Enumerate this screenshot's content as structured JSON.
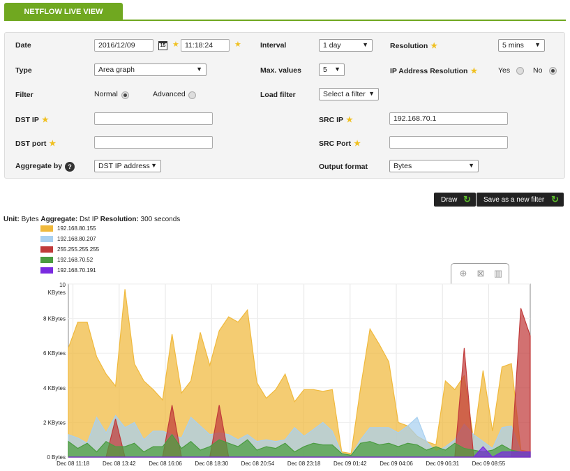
{
  "tab": {
    "label": "NETFLOW LIVE VIEW"
  },
  "form": {
    "date_label": "Date",
    "date_value": "2016/12/09",
    "time_value": "11:18:24",
    "interval_label": "Interval",
    "interval_value": "1 day",
    "resolution_label": "Resolution",
    "resolution_value": "5 mins",
    "type_label": "Type",
    "type_value": "Area graph",
    "maxvalues_label": "Max. values",
    "maxvalues_value": "5",
    "ipres_label": "IP Address Resolution",
    "yes_label": "Yes",
    "no_label": "No",
    "filter_label": "Filter",
    "normal_label": "Normal",
    "advanced_label": "Advanced",
    "loadfilter_label": "Load filter",
    "loadfilter_value": "Select a filter",
    "dstip_label": "DST IP",
    "dstip_value": "",
    "srcip_label": "SRC IP",
    "srcip_value": "192.168.70.1",
    "dstport_label": "DST port",
    "dstport_value": "",
    "srcport_label": "SRC Port",
    "srcport_value": "",
    "aggregate_label": "Aggregate by",
    "aggregate_value": "DST IP address",
    "output_label": "Output format",
    "output_value": "Bytes",
    "calendar_day": "15"
  },
  "buttons": {
    "draw": "Draw",
    "save": "Save as a new filter"
  },
  "summary": {
    "unit_label": "Unit:",
    "unit_value": "Bytes",
    "agg_label": "Aggregate:",
    "agg_value": "Dst IP",
    "res_label": "Resolution:",
    "res_value": "300 seconds"
  },
  "icons": {
    "zoom": "zoom-icon",
    "reset": "reset-zoom-icon",
    "chart": "chart-type-icon",
    "refresh": "refresh-icon",
    "help": "help-icon",
    "calendar": "calendar-icon"
  },
  "colors": {
    "accent": "#70a820"
  },
  "chart_data": {
    "type": "area",
    "ylabel": "",
    "ylim": [
      0,
      10
    ],
    "yticks": [
      "0 Bytes",
      "2 KBytes",
      "4 KBytes",
      "6 KBytes",
      "8 KBytes",
      "10 KBytes"
    ],
    "ytick_values": [
      0,
      2,
      4,
      6,
      8,
      10
    ],
    "xticks": [
      "Dec 08 11:18",
      "Dec 08 13:42",
      "Dec 08 16:06",
      "Dec 08 18:30",
      "Dec 08 20:54",
      "Dec 08 23:18",
      "Dec 09 01:42",
      "Dec 09 04:06",
      "Dec 09 06:31",
      "Dec 09 08:55"
    ],
    "grid": true,
    "legend_position": "top-left",
    "series": [
      {
        "name": "192.168.80.155",
        "color": "#f0b93c",
        "values": [
          6.3,
          7.8,
          7.8,
          5.8,
          4.8,
          4.1,
          9.7,
          5.4,
          4.4,
          3.9,
          3.3,
          7.1,
          3.7,
          4.4,
          7.2,
          5.3,
          7.3,
          8.1,
          7.8,
          8.5,
          4.3,
          3.4,
          3.9,
          4.8,
          3.2,
          3.9,
          3.9,
          3.8,
          3.9,
          0.3,
          0.2,
          4.0,
          7.4,
          6.5,
          5.5,
          2.0,
          1.8,
          1.2,
          0.9,
          0.7,
          4.4,
          3.9,
          4.7,
          1.0,
          5.0,
          1.5,
          5.2,
          5.4,
          0.4,
          0.3
        ]
      },
      {
        "name": "192.168.80.207",
        "color": "#a8d0f0",
        "values": [
          1.3,
          1.1,
          0.8,
          2.3,
          1.4,
          2.4,
          1.7,
          2.0,
          1.0,
          1.5,
          1.5,
          1.3,
          1.1,
          2.3,
          1.8,
          1.3,
          1.4,
          1.3,
          1.0,
          1.3,
          0.9,
          1.0,
          0.9,
          1.0,
          1.7,
          1.2,
          1.6,
          2.0,
          1.5,
          0.2,
          0.1,
          1.0,
          1.7,
          1.7,
          1.7,
          1.4,
          1.8,
          2.3,
          0.9,
          0.3,
          0.6,
          1.0,
          1.9,
          1.3,
          0.9,
          0.5,
          1.7,
          1.8,
          0.3,
          0.3
        ]
      },
      {
        "name": "255.255.255.255",
        "color": "#c03a3a",
        "values": [
          0,
          0,
          0,
          0,
          0,
          2.2,
          0,
          0,
          0,
          0,
          0,
          3.0,
          0,
          0,
          0,
          0,
          3.0,
          0,
          0,
          0,
          0,
          0,
          0,
          0,
          0,
          0,
          0,
          0,
          0,
          0,
          0,
          0,
          0,
          0,
          0,
          0,
          0,
          0,
          0,
          0,
          0,
          0,
          6.3,
          0,
          0,
          0,
          0,
          0,
          8.6,
          7.0
        ]
      },
      {
        "name": "192.168.70.52",
        "color": "#4a9c40",
        "values": [
          0.9,
          0.5,
          0.8,
          0.3,
          0.9,
          0.6,
          0.6,
          0.8,
          0.3,
          0.6,
          0.6,
          1.3,
          0.5,
          0.9,
          0.4,
          0.6,
          1.0,
          0.8,
          0.6,
          1.0,
          0.4,
          0.6,
          0.5,
          0.8,
          0.3,
          0.6,
          0.8,
          0.7,
          0.7,
          0.2,
          0.1,
          0.8,
          0.9,
          0.7,
          0.8,
          0.6,
          0.8,
          0.7,
          0.4,
          0.6,
          0.4,
          0.8,
          0.5,
          0.4,
          0.3,
          0.4,
          0.7,
          0.4,
          0.3,
          0.3
        ]
      },
      {
        "name": "192.168.70.191",
        "color": "#7a2be0",
        "values": [
          0,
          0,
          0,
          0,
          0,
          0,
          0,
          0,
          0,
          0,
          0,
          0,
          0,
          0,
          0,
          0,
          0,
          0,
          0,
          0,
          0,
          0,
          0,
          0,
          0,
          0,
          0,
          0,
          0,
          0,
          0,
          0,
          0,
          0,
          0,
          0,
          0,
          0,
          0,
          0,
          0,
          0,
          0,
          0,
          0.6,
          0,
          0.3,
          0.3,
          0.3,
          0.3
        ]
      }
    ]
  }
}
